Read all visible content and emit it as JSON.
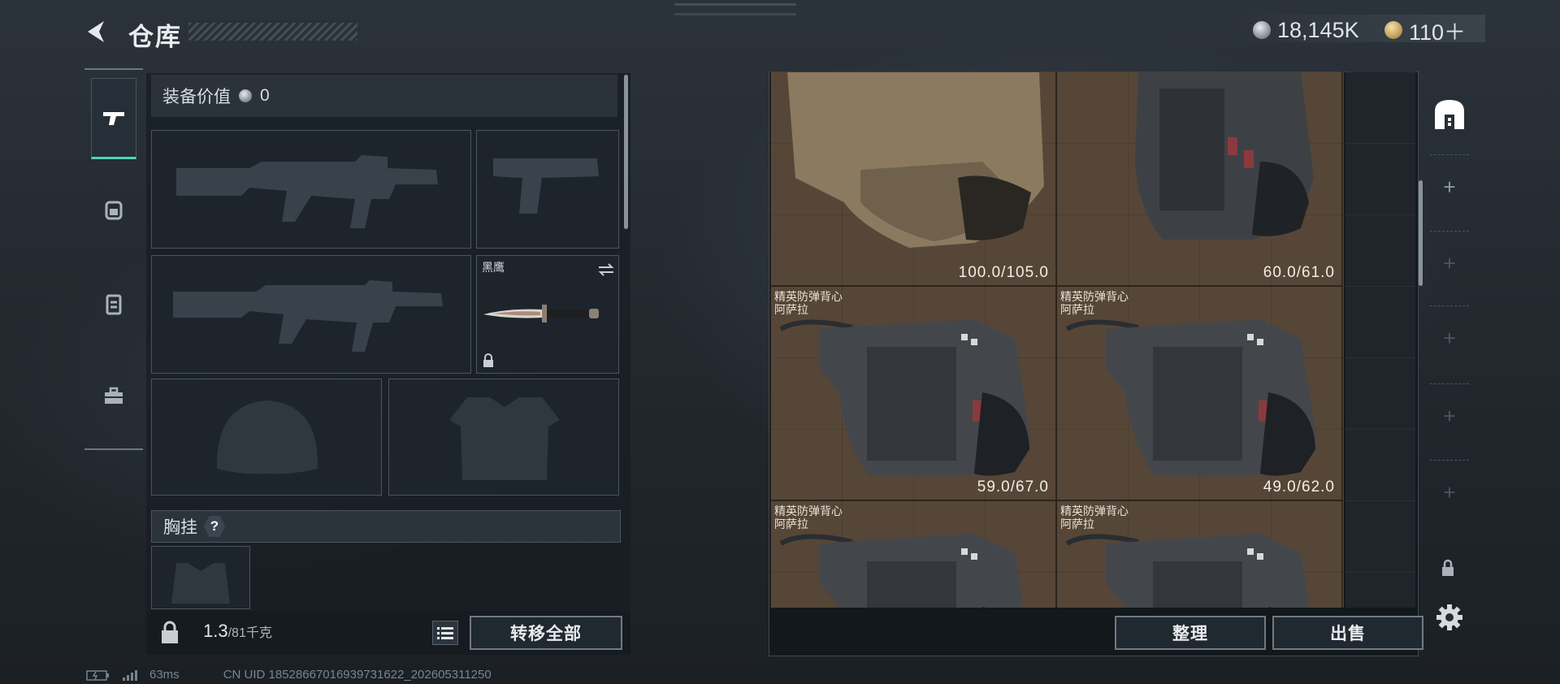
{
  "header": {
    "title": "仓库",
    "currencies": [
      {
        "icon": "silver-coin-icon",
        "amount": "18,145K"
      },
      {
        "icon": "gold-coin-icon",
        "amount": "110＋"
      }
    ]
  },
  "tabs": [
    {
      "icon": "pistol-icon",
      "active": true
    },
    {
      "icon": "backpack-icon",
      "active": false
    },
    {
      "icon": "vest-icon",
      "active": false
    },
    {
      "icon": "toolbox-icon",
      "active": false
    }
  ],
  "loadout": {
    "value_label": "装备价值",
    "value_amount": "0",
    "knife_slot_label": "黑鹰",
    "chest_rig_label": "胸挂",
    "help": "?",
    "weight_current": "1.3",
    "weight_max": "/81千克",
    "transfer_all": "转移全部"
  },
  "storage": {
    "items": [
      {
        "name": "",
        "durability": "100.0/105.0"
      },
      {
        "name": "",
        "durability": "60.0/61.0"
      },
      {
        "name": "精英防弹背心\n阿萨拉",
        "durability": "59.0/67.0"
      },
      {
        "name": "精英防弹背心\n阿萨拉",
        "durability": "49.0/62.0"
      },
      {
        "name": "精英防弹背心\n阿萨拉",
        "durability": ""
      },
      {
        "name": "精英防弹背心\n阿萨拉",
        "durability": ""
      }
    ],
    "sort_label": "整理",
    "sell_label": "出售"
  },
  "sidebar": {
    "add_symbol": "+"
  },
  "footer": {
    "ping": "63ms",
    "uid": "CN UID 18528667016939731622_202605311250"
  },
  "colors": {
    "accent_teal": "#4fd5b7",
    "grid_brown": "#4f4033"
  }
}
